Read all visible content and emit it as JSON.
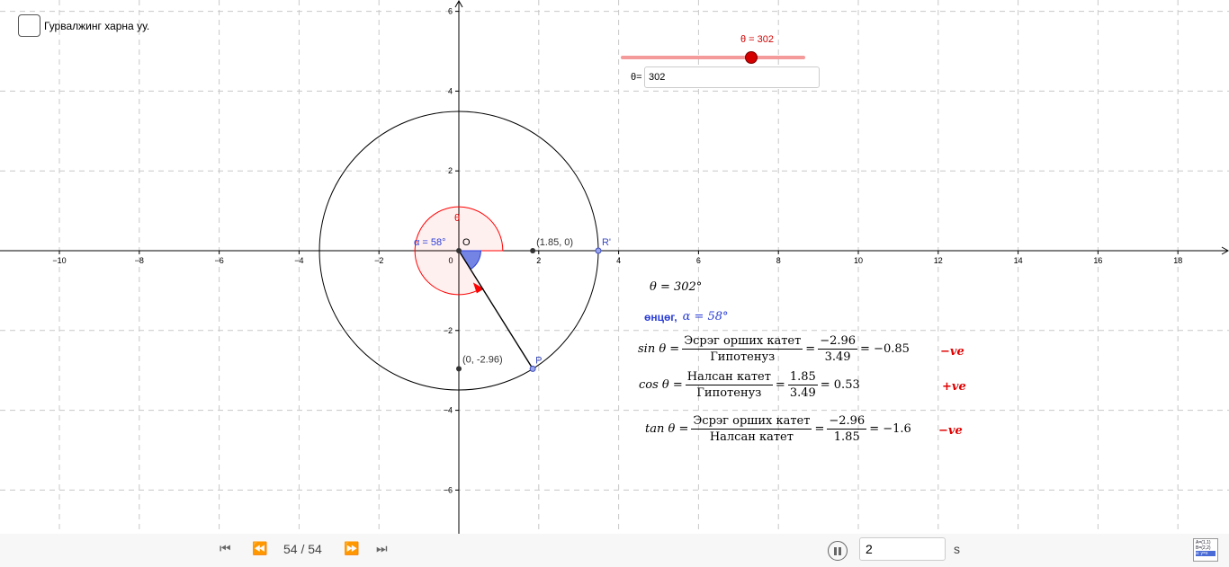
{
  "checkbox": {
    "label": "Гурвалжинг харна уу."
  },
  "slider": {
    "label": "θ = 302",
    "value": 302,
    "min": 0,
    "max": 360
  },
  "input": {
    "prefix": "θ=",
    "value": "302"
  },
  "axes": {
    "x_ticks": [
      "−10",
      "−8",
      "−6",
      "−4",
      "−2",
      "0",
      "2",
      "4",
      "6",
      "8",
      "10",
      "12",
      "14",
      "16",
      "18"
    ],
    "y_ticks": [
      "6",
      "4",
      "2",
      "−2",
      "−4",
      "−6"
    ]
  },
  "geometry": {
    "theta_label": "θ",
    "alpha_label": "α = 58°",
    "origin_label": "O",
    "x_point_label": "(1.85, 0)",
    "y_point_label": "(0, -2.96)",
    "r_label": "R'",
    "p_label": "P"
  },
  "formulas": {
    "theta_line": "θ = 302°",
    "alpha_prefix": "өнцөг,",
    "alpha_value": "α = 58°",
    "sin": {
      "lhs": "sin θ =",
      "num": "Эсрэг орших катет",
      "den": "Гипотенуз",
      "num2": "−2.96",
      "den2": "3.49",
      "result": "= −0.85",
      "sign": "−ve"
    },
    "cos": {
      "lhs": "cos θ =",
      "num": "Налсан катет",
      "den": "Гипотенуз",
      "num2": "1.85",
      "den2": "3.49",
      "result": "= 0.53",
      "sign": "+ve"
    },
    "tan": {
      "lhs": "tan θ =",
      "num": "Эсрэг орших катет",
      "den": "Налсан катет",
      "num2": "−2.96",
      "den2": "1.85",
      "result": "= −1.6",
      "sign": "−ve"
    }
  },
  "playback": {
    "counter": "54 / 54",
    "speed": "2",
    "unit": "s"
  },
  "algebra_button": {
    "line1": "A=(1,1)",
    "line2": "B=(2,2)",
    "line3": "a: y=x"
  },
  "colors": {
    "accent": "#d40000",
    "blue": "#2b3ed6",
    "grid": "#c8c8c8"
  }
}
